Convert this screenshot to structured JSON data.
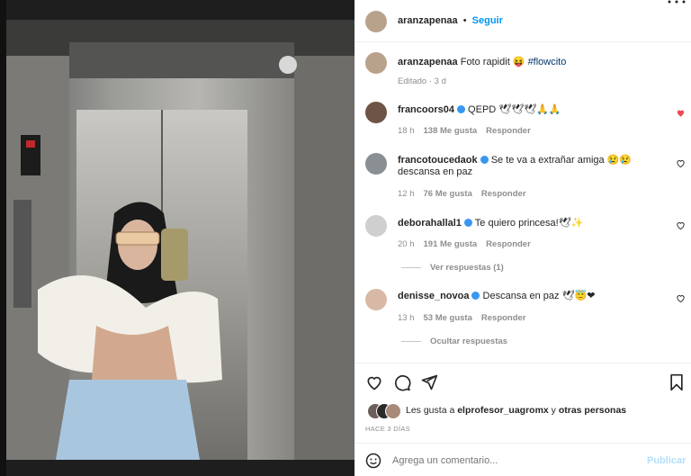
{
  "post": {
    "username": "aranzapenaa",
    "follow_label": "Seguir",
    "caption_user": "aranzapenaa",
    "caption_text": "Foto rapidit 😝",
    "caption_hashtag": "#flowcito",
    "edited": "Editado · 3 d"
  },
  "comments": [
    {
      "user": "francoors04",
      "text": "QEPD 🕊🕊🕊🙏🙏",
      "time": "18 h",
      "likes": "138 Me gusta",
      "reply": "Responder",
      "liked": true
    },
    {
      "user": "francotoucedaok",
      "text": "Se te va a extrañar amiga 😢😢 descansa en paz",
      "time": "12 h",
      "likes": "76 Me gusta",
      "reply": "Responder",
      "liked": false
    },
    {
      "user": "deborahallal1",
      "text": "Te quiero princesa!🕊✨",
      "time": "20 h",
      "likes": "191 Me gusta",
      "reply": "Responder",
      "liked": false,
      "view_replies": "Ver respuestas (1)"
    },
    {
      "user": "denisse_novoa",
      "text": "Descansa en paz 🕊😇❤",
      "time": "13 h",
      "likes": "53 Me gusta",
      "reply": "Responder",
      "liked": false,
      "hide_replies": "Ocultar respuestas"
    }
  ],
  "likes_bar": {
    "prefix": "Les gusta a",
    "user": "elprofesor_uagromx",
    "middle": "y",
    "others": "otras personas",
    "date": "HACE 3 DÍAS"
  },
  "composer": {
    "placeholder": "Agrega un comentario...",
    "publish": "Publicar"
  },
  "colors": {
    "link_blue": "#0095f6",
    "verified": "#3897f0",
    "liked_red": "#ed4956",
    "meta_gray": "#8e8e8e"
  },
  "icons": [
    "more-icon",
    "heart-icon",
    "comment-icon",
    "share-icon",
    "save-icon",
    "emoji-icon",
    "verified-icon"
  ]
}
